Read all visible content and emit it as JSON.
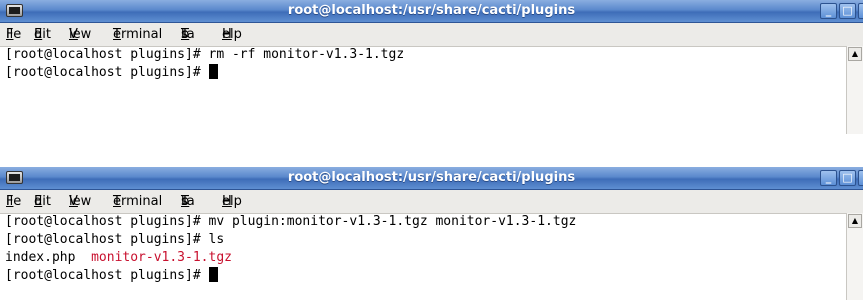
{
  "windows": [
    {
      "title": "root@localhost:/usr/share/cacti/plugins",
      "menu": [
        {
          "pre": "",
          "u": "F",
          "post": "ile"
        },
        {
          "pre": "",
          "u": "E",
          "post": "dit"
        },
        {
          "pre": "",
          "u": "V",
          "post": "iew"
        },
        {
          "pre": "",
          "u": "T",
          "post": "erminal"
        },
        {
          "pre": "Ta",
          "u": "b",
          "post": "s"
        },
        {
          "pre": "",
          "u": "H",
          "post": "elp"
        }
      ],
      "lines": [
        "[root@localhost plugins]# rm -rf monitor-v1.3-1.tgz",
        "[root@localhost plugins]# "
      ]
    },
    {
      "title": "root@localhost:/usr/share/cacti/plugins",
      "menu": [
        {
          "pre": "",
          "u": "F",
          "post": "ile"
        },
        {
          "pre": "",
          "u": "E",
          "post": "dit"
        },
        {
          "pre": "",
          "u": "V",
          "post": "iew"
        },
        {
          "pre": "",
          "u": "T",
          "post": "erminal"
        },
        {
          "pre": "Ta",
          "u": "b",
          "post": "s"
        },
        {
          "pre": "",
          "u": "H",
          "post": "elp"
        }
      ],
      "lines": [
        "[root@localhost plugins]# mv plugin:monitor-v1.3-1.tgz monitor-v1.3-1.tgz",
        "[root@localhost plugins]# ls",
        {
          "a": "index.php  ",
          "b": "monitor-v1.3-1.tgz"
        },
        "[root@localhost plugins]# "
      ]
    }
  ],
  "icons": {
    "app": "terminal-icon",
    "minimize": "minimize-icon",
    "maximize": "maximize-icon",
    "close": "close-icon",
    "scroll_up": "scroll-up-arrow-icon"
  },
  "glyphs": {
    "minimize": "_",
    "maximize": "□",
    "close": "✕",
    "scroll_up": "▲"
  },
  "colors": {
    "titlebar": "#4a7ac4",
    "menubar": "#ecebe8",
    "terminal_bg": "#ffffff",
    "terminal_fg": "#000000",
    "archive_file": "#c8102e"
  }
}
